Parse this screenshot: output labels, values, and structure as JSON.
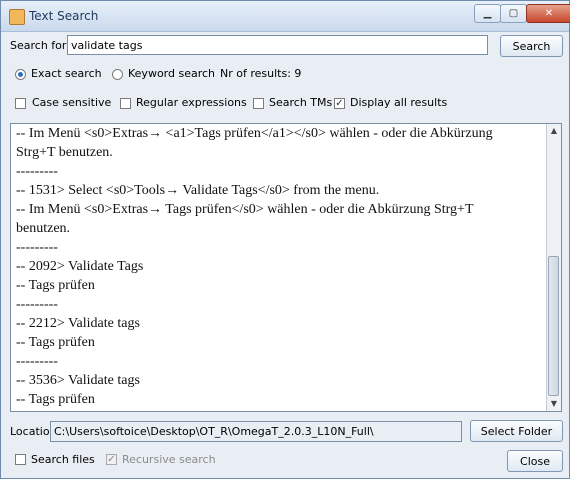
{
  "window": {
    "title": "Text Search"
  },
  "search": {
    "label": "Search for:",
    "value": "validate tags",
    "button": "Search"
  },
  "mode": {
    "exact": "Exact search",
    "keyword": "Keyword search",
    "results_count": "Nr of results: 9",
    "selected": "exact"
  },
  "options": {
    "case_sensitive": "Case sensitive",
    "regular_expressions": "Regular expressions",
    "search_tms": "Search TMs",
    "display_all": "Display all results"
  },
  "results": {
    "lines": [
      "-- Im Menü <s0>Extras→ <a1>Tags prüfen</a1></s0> wählen - oder die Abkürzung",
      "Strg+T  benutzen.",
      "---------",
      "-- 1531> Select <s0>Tools→ Validate Tags</s0> from the menu.",
      "-- Im Menü <s0>Extras→ Tags prüfen</s0> wählen - oder die Abkürzung Strg+T",
      "benutzen.",
      "---------",
      "-- 2092> Validate Tags",
      "-- Tags prüfen",
      "---------",
      "-- 2212> Validate tags",
      "-- Tags prüfen",
      "---------",
      "-- 3536> Validate tags",
      "-- Tags prüfen"
    ]
  },
  "location": {
    "label": "Location",
    "value": "C:\\Users\\softoice\\Desktop\\OT_R\\OmegaT_2.0.3_L10N_Full\\",
    "button": "Select Folder"
  },
  "footer": {
    "search_files": "Search files",
    "recursive": "Recursive search",
    "close": "Close"
  },
  "icons": {
    "app": "java-cup-icon",
    "minimize": "minimize-icon",
    "maximize": "maximize-icon",
    "close": "close-icon"
  }
}
